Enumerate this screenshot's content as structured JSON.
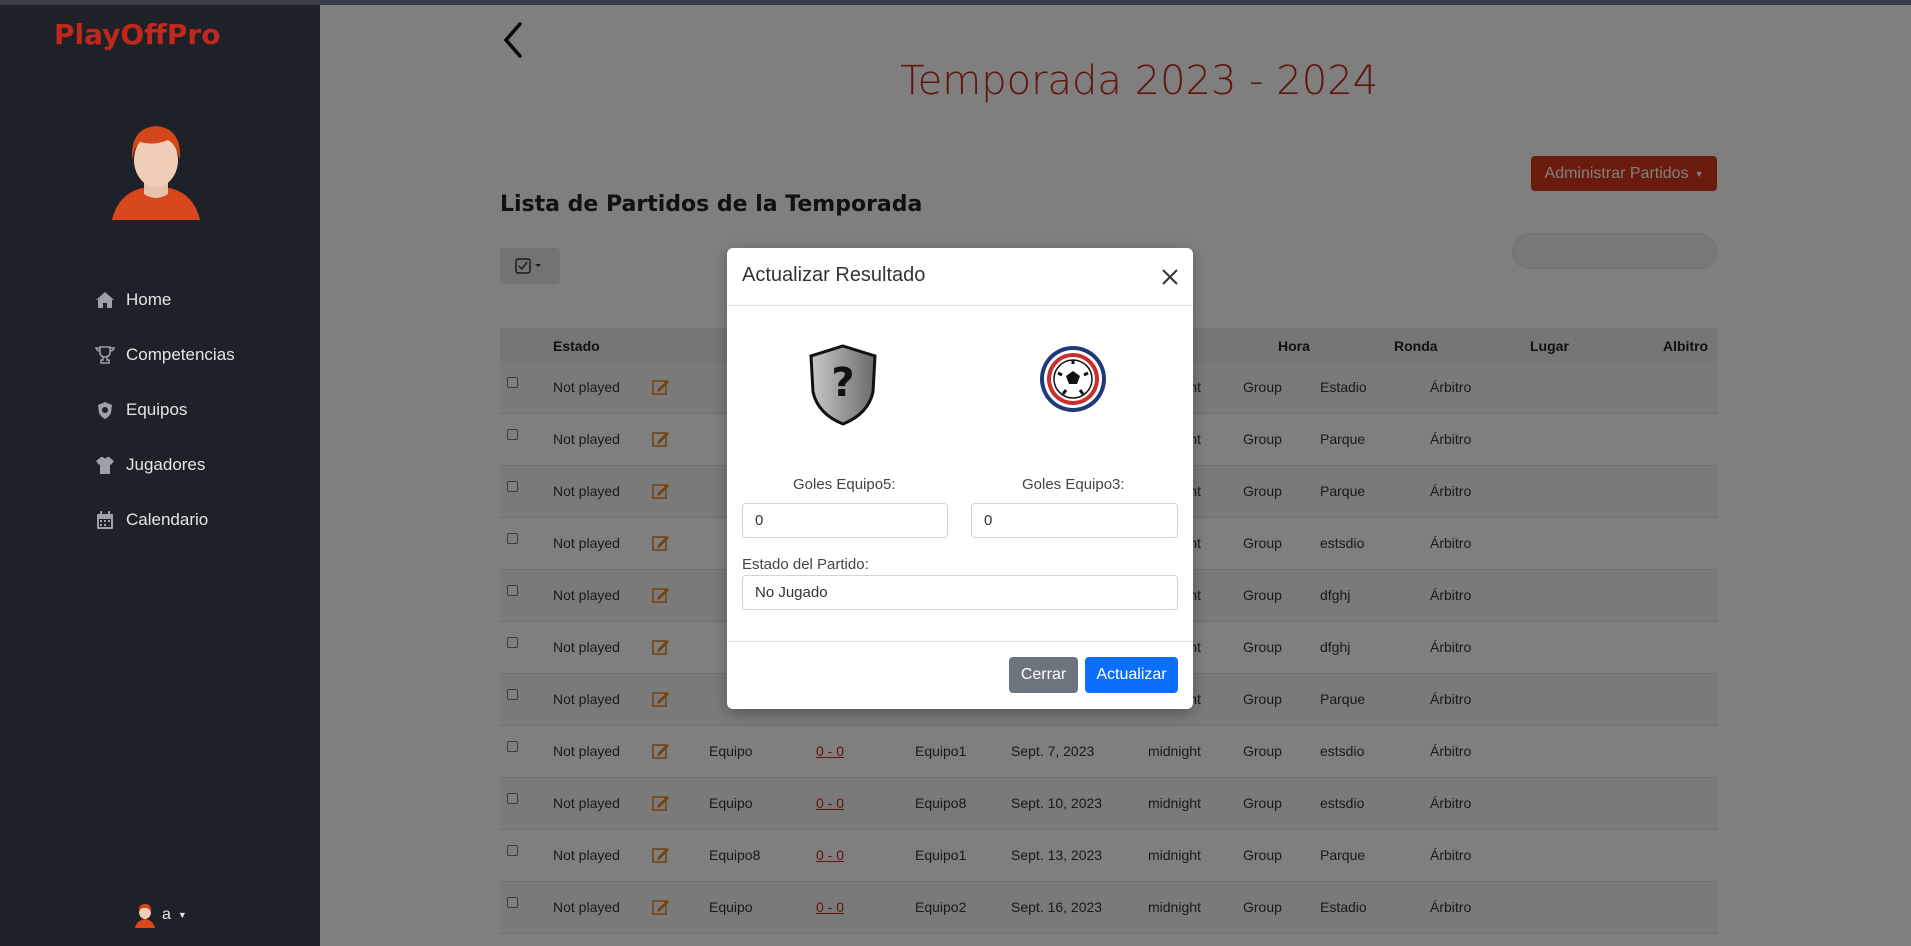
{
  "brand": "PlayOffPro",
  "sidebar": {
    "items": [
      {
        "label": "Home",
        "icon": "home-icon"
      },
      {
        "label": "Competencias",
        "icon": "trophy-icon"
      },
      {
        "label": "Equipos",
        "icon": "team-badge-icon"
      },
      {
        "label": "Jugadores",
        "icon": "jersey-icon"
      },
      {
        "label": "Calendario",
        "icon": "calendar-icon"
      }
    ],
    "user": "a"
  },
  "main": {
    "title": "Temporada 2023 - 2024",
    "admin_button": "Administrar Partidos",
    "list_title": "Lista de Partidos de la Temporada"
  },
  "table": {
    "headers": {
      "estado": "Estado",
      "hora": "Hora",
      "ronda": "Ronda",
      "lugar": "Lugar",
      "albitro": "Albitro"
    },
    "rows": [
      {
        "estado": "Not played",
        "local": "",
        "score": "",
        "visit": "",
        "fecha": "",
        "hora": "midnight",
        "ronda": "Group",
        "lugar": "Estadio",
        "albitro": "Árbitro"
      },
      {
        "estado": "Not played",
        "local": "",
        "score": "",
        "visit": "",
        "fecha": "",
        "hora": "midnight",
        "ronda": "Group",
        "lugar": "Parque",
        "albitro": "Árbitro"
      },
      {
        "estado": "Not played",
        "local": "",
        "score": "",
        "visit": "",
        "fecha": "",
        "hora": "midnight",
        "ronda": "Group",
        "lugar": "Parque",
        "albitro": "Árbitro"
      },
      {
        "estado": "Not played",
        "local": "",
        "score": "",
        "visit": "",
        "fecha": "",
        "hora": "midnight",
        "ronda": "Group",
        "lugar": "estsdio",
        "albitro": "Árbitro"
      },
      {
        "estado": "Not played",
        "local": "",
        "score": "",
        "visit": "",
        "fecha": "",
        "hora": "midnight",
        "ronda": "Group",
        "lugar": "dfghj",
        "albitro": "Árbitro"
      },
      {
        "estado": "Not played",
        "local": "",
        "score": "",
        "visit": "",
        "fecha": "",
        "hora": "midnight",
        "ronda": "Group",
        "lugar": "dfghj",
        "albitro": "Árbitro"
      },
      {
        "estado": "Not played",
        "local": "",
        "score": "",
        "visit": "",
        "fecha": "",
        "hora": "midnight",
        "ronda": "Group",
        "lugar": "Parque",
        "albitro": "Árbitro"
      },
      {
        "estado": "Not played",
        "local": "Equipo",
        "score": "0 - 0",
        "visit": "Equipo1",
        "fecha": "Sept. 7, 2023",
        "hora": "midnight",
        "ronda": "Group",
        "lugar": "estsdio",
        "albitro": "Árbitro"
      },
      {
        "estado": "Not played",
        "local": "Equipo",
        "score": "0 - 0",
        "visit": "Equipo8",
        "fecha": "Sept. 10, 2023",
        "hora": "midnight",
        "ronda": "Group",
        "lugar": "estsdio",
        "albitro": "Árbitro"
      },
      {
        "estado": "Not played",
        "local": "Equipo8",
        "score": "0 - 0",
        "visit": "Equipo1",
        "fecha": "Sept. 13, 2023",
        "hora": "midnight",
        "ronda": "Group",
        "lugar": "Parque",
        "albitro": "Árbitro"
      },
      {
        "estado": "Not played",
        "local": "Equipo",
        "score": "0 - 0",
        "visit": "Equipo2",
        "fecha": "Sept. 16, 2023",
        "hora": "midnight",
        "ronda": "Group",
        "lugar": "Estadio",
        "albitro": "Árbitro"
      }
    ]
  },
  "modal": {
    "title": "Actualizar Resultado",
    "home_label": "Goles Equipo5:",
    "away_label": "Goles Equipo3:",
    "home_goals": "0",
    "away_goals": "0",
    "status_label": "Estado del Partido:",
    "status_value": "No Jugado",
    "close_button": "Cerrar",
    "update_button": "Actualizar"
  },
  "colors": {
    "brand": "#c0281c",
    "admin_button": "#d7361c",
    "primary": "#0d6efd",
    "secondary": "#6c757d",
    "sidebar": "#1e2128"
  }
}
